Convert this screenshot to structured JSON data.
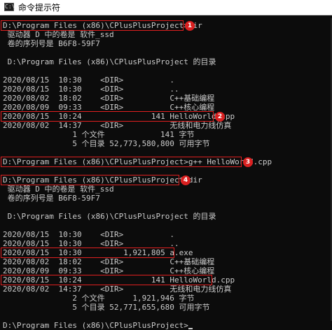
{
  "window": {
    "title": "命令提示符",
    "icon": "cmd-icon",
    "icon_glyph": "C:\\"
  },
  "console": {
    "lines": [
      "D:\\Program Files (x86)\\CPlusPlusProject>dir",
      " 驱动器 D 中的卷是 软件_ssd",
      " 卷的序列号是 B6F8-59F7",
      "",
      " D:\\Program Files (x86)\\CPlusPlusProject 的目录",
      "",
      "2020/08/15  10:30    <DIR>          .",
      "2020/08/15  10:30    <DIR>          ..",
      "2020/08/02  18:02    <DIR>          C++基础编程",
      "2020/08/09  09:33    <DIR>          C++核心编程",
      "2020/08/15  10:24               141 HelloWorld.cpp",
      "2020/08/02  14:37    <DIR>          无线和电力线仿真",
      "               1 个文件            141 字节",
      "               5 个目录 52,773,580,800 可用字节",
      "",
      "D:\\Program Files (x86)\\CPlusPlusProject>g++ HelloWorld.cpp",
      "",
      "D:\\Program Files (x86)\\CPlusPlusProject>dir",
      " 驱动器 D 中的卷是 软件_ssd",
      " 卷的序列号是 B6F8-59F7",
      "",
      " D:\\Program Files (x86)\\CPlusPlusProject 的目录",
      "",
      "2020/08/15  10:30    <DIR>          .",
      "2020/08/15  10:30    <DIR>          ..",
      "2020/08/15  10:30         1,921,805 a.exe",
      "2020/08/02  18:02    <DIR>          C++基础编程",
      "2020/08/09  09:33    <DIR>          C++核心编程",
      "2020/08/15  10:24               141 HelloWorld.cpp",
      "2020/08/02  14:37    <DIR>          无线和电力线仿真",
      "               2 个文件      1,921,946 字节",
      "               5 个目录 52,771,655,680 可用字节",
      "",
      "D:\\Program Files (x86)\\CPlusPlusProject>"
    ]
  },
  "annotations": {
    "badge_1": "1",
    "badge_2": "2",
    "badge_3": "3",
    "badge_4": "4",
    "color": "#e02020"
  }
}
